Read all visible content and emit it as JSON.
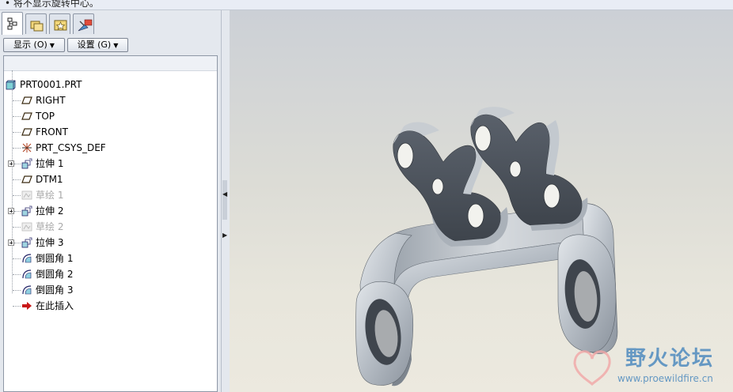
{
  "message_bar": {
    "text": "• 将不显示旋转中心。"
  },
  "tabs": [
    {
      "name": "model-tree-tab",
      "icon": "model-tree-icon"
    },
    {
      "name": "folder-browser-tab",
      "icon": "folder-browser-icon"
    },
    {
      "name": "favorites-tab",
      "icon": "favorites-icon"
    },
    {
      "name": "connections-tab",
      "icon": "connections-icon"
    }
  ],
  "toolbar": {
    "show_label": "显示 (O)",
    "settings_label": "设置 (G)"
  },
  "tree": {
    "root": "PRT0001.PRT",
    "items": [
      {
        "label": "RIGHT",
        "icon": "datum-plane-icon",
        "expandable": false,
        "grayed": false
      },
      {
        "label": "TOP",
        "icon": "datum-plane-icon",
        "expandable": false,
        "grayed": false
      },
      {
        "label": "FRONT",
        "icon": "datum-plane-icon",
        "expandable": false,
        "grayed": false
      },
      {
        "label": "PRT_CSYS_DEF",
        "icon": "coordinate-system-icon",
        "expandable": false,
        "grayed": false
      },
      {
        "label": "拉伸 1",
        "icon": "extrude-icon",
        "expandable": true,
        "grayed": false
      },
      {
        "label": "DTM1",
        "icon": "datum-plane-icon",
        "expandable": false,
        "grayed": false
      },
      {
        "label": "草绘 1",
        "icon": "sketch-icon",
        "expandable": false,
        "grayed": true
      },
      {
        "label": "拉伸 2",
        "icon": "extrude-icon",
        "expandable": true,
        "grayed": false
      },
      {
        "label": "草绘 2",
        "icon": "sketch-icon",
        "expandable": false,
        "grayed": true
      },
      {
        "label": "拉伸 3",
        "icon": "extrude-icon",
        "expandable": true,
        "grayed": false
      },
      {
        "label": "倒圆角 1",
        "icon": "round-icon",
        "expandable": false,
        "grayed": false
      },
      {
        "label": "倒圆角 2",
        "icon": "round-icon",
        "expandable": false,
        "grayed": false
      },
      {
        "label": "倒圆角 3",
        "icon": "round-icon",
        "expandable": false,
        "grayed": false
      },
      {
        "label": "在此插入",
        "icon": "insert-here-arrow-icon",
        "expandable": false,
        "grayed": false
      }
    ]
  },
  "watermark": {
    "title": "野火论坛",
    "url": "www.proewildfire.cn"
  }
}
